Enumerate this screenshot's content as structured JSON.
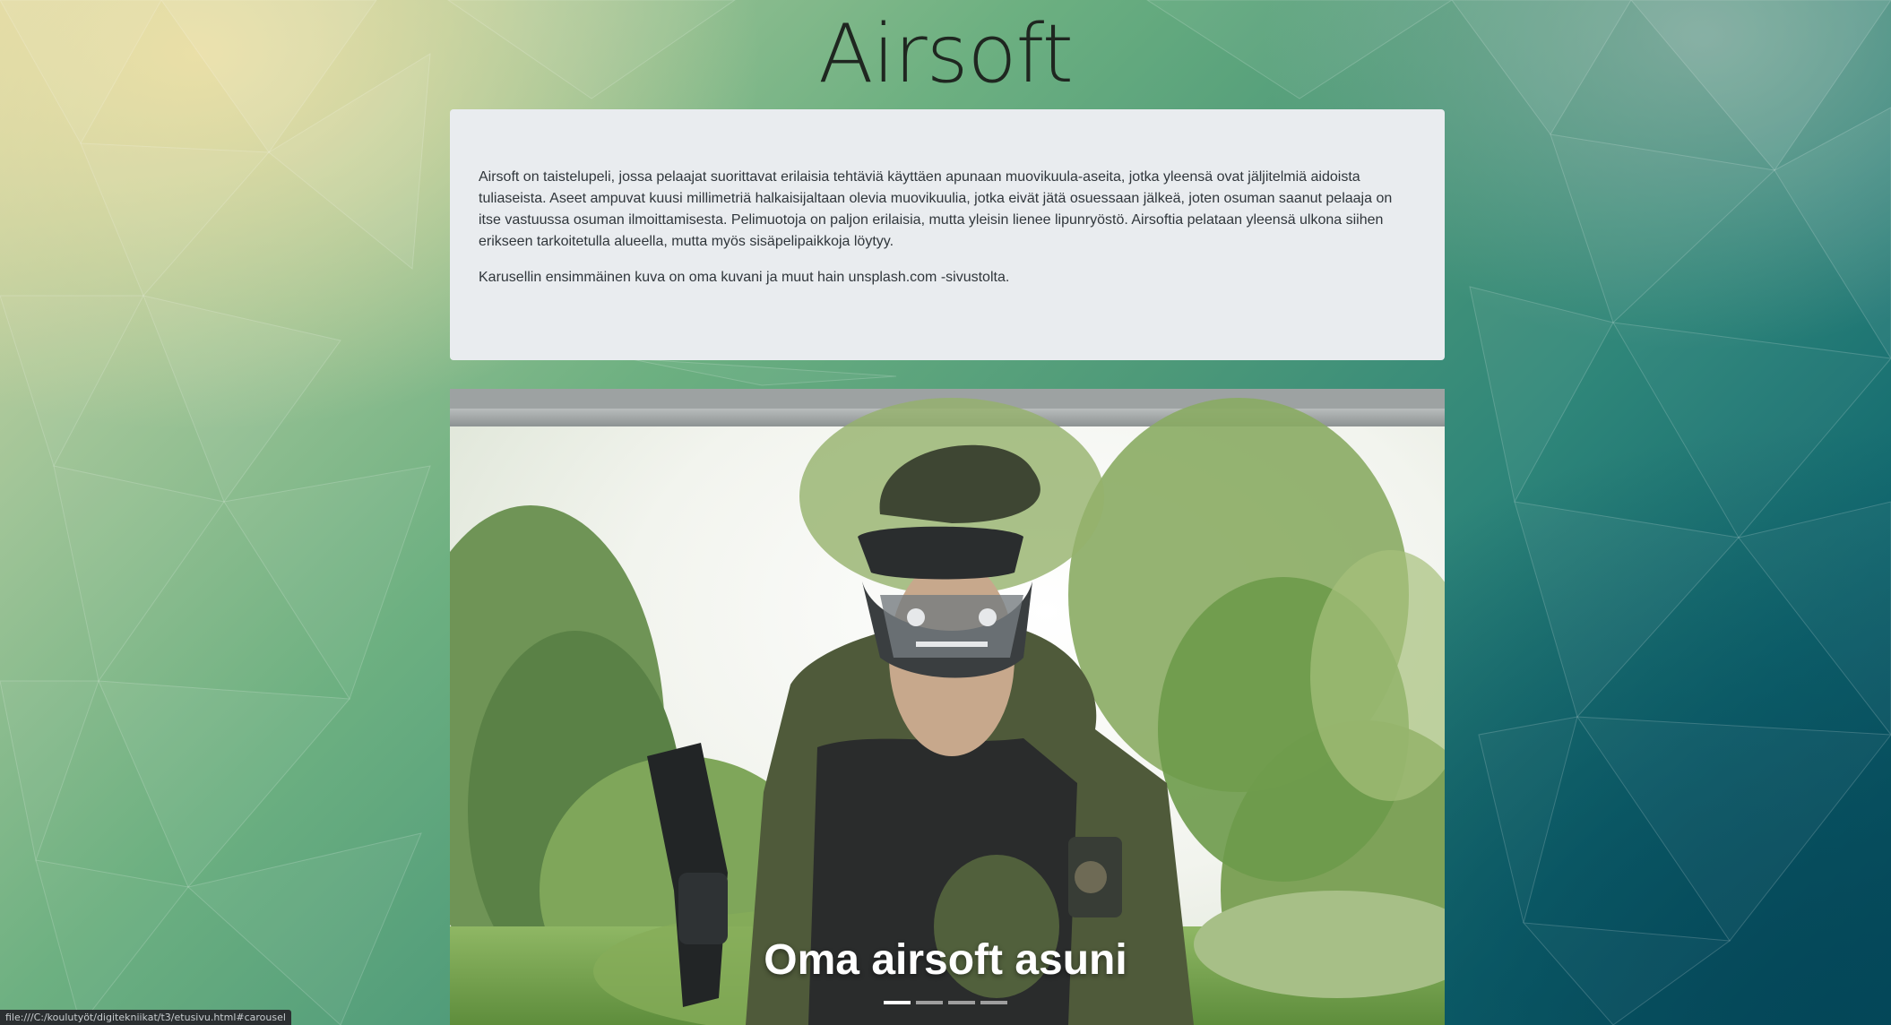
{
  "page": {
    "title": "Airsoft"
  },
  "intro": {
    "paragraph1": "Airsoft on taistelupeli, jossa pelaajat suorittavat erilaisia tehtäviä käyttäen apunaan muovikuula-aseita, jotka yleensä ovat jäljitelmiä aidoista tuliaseista. Aseet ampuvat kuusi millimetriä halkaisijaltaan olevia muovikuulia, jotka eivät jätä osuessaan jälkeä, joten osuman saanut pelaaja on itse vastuussa osuman ilmoittamisesta. Pelimuotoja on paljon erilaisia, mutta yleisin lienee lipunryöstö. Airsoftia pelataan yleensä ulkona siihen erikseen tarkoitetulla alueella, mutta myös sisäpelipaikkoja löytyy.",
    "paragraph2": "Karusellin ensimmäinen kuva on oma kuvani ja muut hain unsplash.com -sivustolta."
  },
  "carousel": {
    "caption": "Oma airsoft asuni",
    "slide_count": 4,
    "active_index": 0,
    "indicators": [
      {
        "label": "Slide 1"
      },
      {
        "label": "Slide 2"
      },
      {
        "label": "Slide 3"
      },
      {
        "label": "Slide 4"
      }
    ]
  },
  "status_bar": {
    "url": "file:///C:/koulutyöt/digitekniikat/t3/etusivu.html#carousel"
  },
  "colors": {
    "card_background": "#e9ecef",
    "title_text": "#1f2620",
    "body_text": "#30363b",
    "caption_text": "#ffffff"
  }
}
